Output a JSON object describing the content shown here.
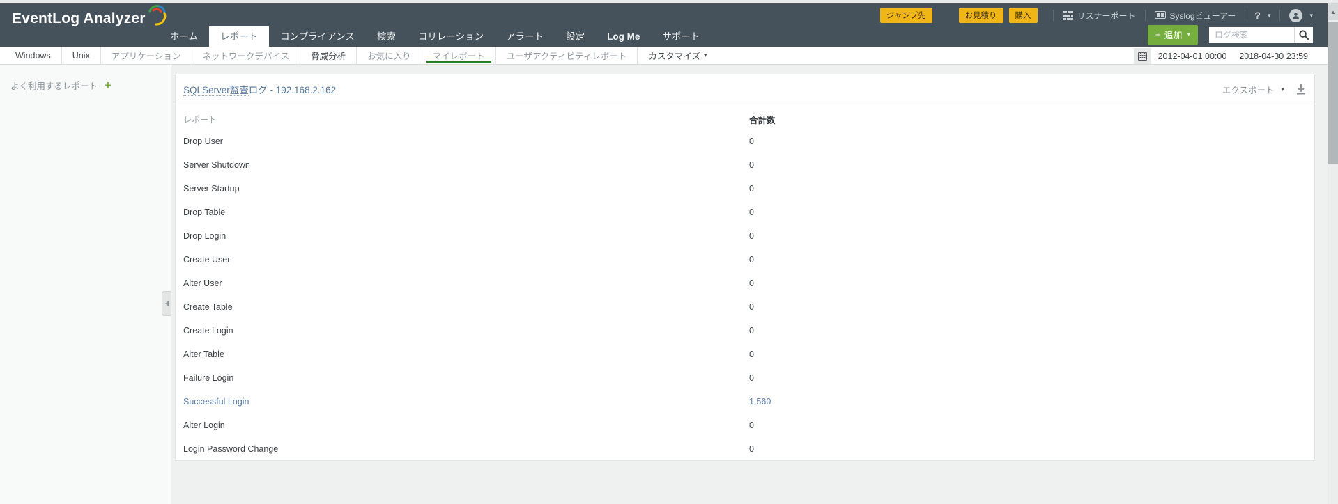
{
  "header": {
    "logo_text": "EventLog Analyzer",
    "promo_buttons": [
      {
        "label": "ジャンプ先"
      },
      {
        "label": "お見積り"
      },
      {
        "label": "購入"
      }
    ],
    "utility": {
      "listener_port": "リスナーポート",
      "syslog_viewer": "Syslogビューアー",
      "help": "?"
    },
    "nav_items": [
      {
        "label": "ホーム",
        "active": false,
        "en": false
      },
      {
        "label": "レポート",
        "active": true,
        "en": false
      },
      {
        "label": "コンプライアンス",
        "active": false,
        "en": false
      },
      {
        "label": "検索",
        "active": false,
        "en": false
      },
      {
        "label": "コリレーション",
        "active": false,
        "en": false
      },
      {
        "label": "アラート",
        "active": false,
        "en": false
      },
      {
        "label": "設定",
        "active": false,
        "en": false
      },
      {
        "label": "Log Me",
        "active": false,
        "en": true
      },
      {
        "label": "サポート",
        "active": false,
        "en": false
      }
    ],
    "add_button": {
      "plus": "+",
      "label": "追加"
    },
    "search": {
      "placeholder": "ログ検索"
    }
  },
  "subnav": {
    "items": [
      {
        "label": "Windows",
        "tone": "dark",
        "active": false,
        "caret": false
      },
      {
        "label": "Unix",
        "tone": "dark",
        "active": false,
        "caret": false
      },
      {
        "label": "アプリケーション",
        "tone": "light",
        "active": false,
        "caret": false
      },
      {
        "label": "ネットワークデバイス",
        "tone": "light",
        "active": false,
        "caret": false
      },
      {
        "label": "脅威分析",
        "tone": "dark",
        "active": false,
        "caret": false
      },
      {
        "label": "お気に入り",
        "tone": "light",
        "active": false,
        "caret": false
      },
      {
        "label": "マイレポート",
        "tone": "light",
        "active": true,
        "caret": false
      },
      {
        "label": "ユーザアクティビティレポート",
        "tone": "light",
        "active": false,
        "caret": false
      },
      {
        "label": "カスタマイズ",
        "tone": "dark",
        "active": false,
        "caret": true
      }
    ]
  },
  "daterange": {
    "start": "2012-04-01 00:00",
    "end": "2018-04-30 23:59"
  },
  "sidebar": {
    "title": "よく利用するレポート",
    "plus": "+"
  },
  "report": {
    "title_link": "SQLServer監査",
    "title_rest": "ログ - 192.168.2.162",
    "export_label": "エクスポート",
    "columns": {
      "report": "レポート",
      "total": "合計数"
    },
    "rows": [
      {
        "name": "Drop User",
        "value": "0",
        "link": false
      },
      {
        "name": "Server Shutdown",
        "value": "0",
        "link": false
      },
      {
        "name": "Server Startup",
        "value": "0",
        "link": false
      },
      {
        "name": "Drop Table",
        "value": "0",
        "link": false
      },
      {
        "name": "Drop Login",
        "value": "0",
        "link": false
      },
      {
        "name": "Create User",
        "value": "0",
        "link": false
      },
      {
        "name": "Alter User",
        "value": "0",
        "link": false
      },
      {
        "name": "Create Table",
        "value": "0",
        "link": false
      },
      {
        "name": "Create Login",
        "value": "0",
        "link": false
      },
      {
        "name": "Alter Table",
        "value": "0",
        "link": false
      },
      {
        "name": "Failure Login",
        "value": "0",
        "link": false
      },
      {
        "name": "Successful Login",
        "value": "1,560",
        "link": true
      },
      {
        "name": "Alter Login",
        "value": "0",
        "link": false
      },
      {
        "name": "Login Password Change",
        "value": "0",
        "link": false
      }
    ]
  },
  "colors": {
    "header_bg": "#46525b",
    "accent_green": "#76ad3f",
    "active_underline": "#257d25",
    "promo_yellow": "#f0b517",
    "link_blue": "#5a7da6",
    "title_blue": "#54779c"
  }
}
